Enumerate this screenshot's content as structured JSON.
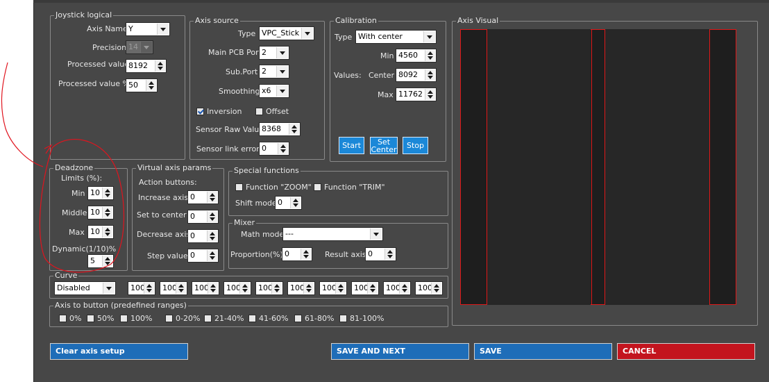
{
  "joystick_logical": {
    "legend": "Joystick logical",
    "axis_name_label": "Axis Name",
    "axis_name_value": "Y",
    "precision_label": "Precision",
    "precision_value": "14",
    "processed_value_label": "Processed value",
    "processed_value": "8192",
    "processed_pct_label": "Processed value %",
    "processed_pct_value": "50"
  },
  "axis_source": {
    "legend": "Axis source",
    "type_label": "Type",
    "type_value": "VPC_Stick",
    "main_pcb_label": "Main PCB Port",
    "main_pcb_value": "2",
    "sub_port_label": "Sub.Port",
    "sub_port_value": "2",
    "smoothing_label": "Smoothing",
    "smoothing_value": "x6",
    "inversion_label": "Inversion",
    "inversion_checked": true,
    "offset_label": "Offset",
    "offset_checked": false,
    "sensor_raw_label": "Sensor Raw Value",
    "sensor_raw_value": "8368",
    "sensor_errors_label": "Sensor link errors",
    "sensor_errors_value": "0"
  },
  "calibration": {
    "legend": "Calibration",
    "type_label": "Type",
    "type_value": "With center",
    "values_label": "Values:",
    "min_label": "Min",
    "min_value": "4560",
    "center_label": "Center",
    "center_value": "8092",
    "max_label": "Max",
    "max_value": "11762",
    "start_button": "Start",
    "set_center_button_line1": "Set",
    "set_center_button_line2": "Center",
    "stop_button": "Stop"
  },
  "axis_visual": {
    "legend": "Axis Visual"
  },
  "deadzone": {
    "legend": "Deadzone",
    "limits_label": "Limits (%):",
    "min_label": "Min",
    "min_value": "10",
    "middle_label": "Middle",
    "middle_value": "10",
    "max_label": "Max",
    "max_value": "10",
    "dynamic_label": "Dynamic(1/10)%",
    "dynamic_value": "5"
  },
  "virtual_axis": {
    "legend": "Virtual axis params",
    "action_buttons_label": "Action buttons:",
    "increase_label": "Increase axis",
    "increase_value": "0",
    "set_center_label": "Set to center",
    "set_center_value": "0",
    "decrease_label": "Decrease axis",
    "decrease_value": "0",
    "step_label": "Step value",
    "step_value": "0"
  },
  "special_functions": {
    "legend": "Special functions",
    "zoom_label": "Function \"ZOOM\"",
    "zoom_checked": false,
    "trim_label": "Function \"TRIM\"",
    "trim_checked": false,
    "shift_label": "Shift mode",
    "shift_value": "0"
  },
  "mixer": {
    "legend": "Mixer",
    "math_label": "Math mode",
    "math_value": "---",
    "proportion_label": "Proportion(%)",
    "proportion_value": "0",
    "result_label": "Result axis",
    "result_value": "0"
  },
  "curve": {
    "legend": "Curve",
    "mode_value": "Disabled",
    "points": [
      "100",
      "100",
      "100",
      "100",
      "100",
      "100",
      "100",
      "100",
      "100",
      "100"
    ]
  },
  "axis_to_button": {
    "legend": "Axis to button (predefined ranges)",
    "options": [
      "0%",
      "50%",
      "100%",
      "0-20%",
      "21-40%",
      "41-60%",
      "61-80%",
      "81-100%"
    ]
  },
  "buttons": {
    "clear": "Clear axis setup",
    "save_next": "SAVE AND NEXT",
    "save": "SAVE",
    "cancel": "CANCEL"
  },
  "colors": {
    "panel_bg": "#474747",
    "accent_blue": "#1e6db8",
    "cancel_red": "#c3141e",
    "visual_red": "#e01818",
    "annotation_red": "#e0141e"
  }
}
